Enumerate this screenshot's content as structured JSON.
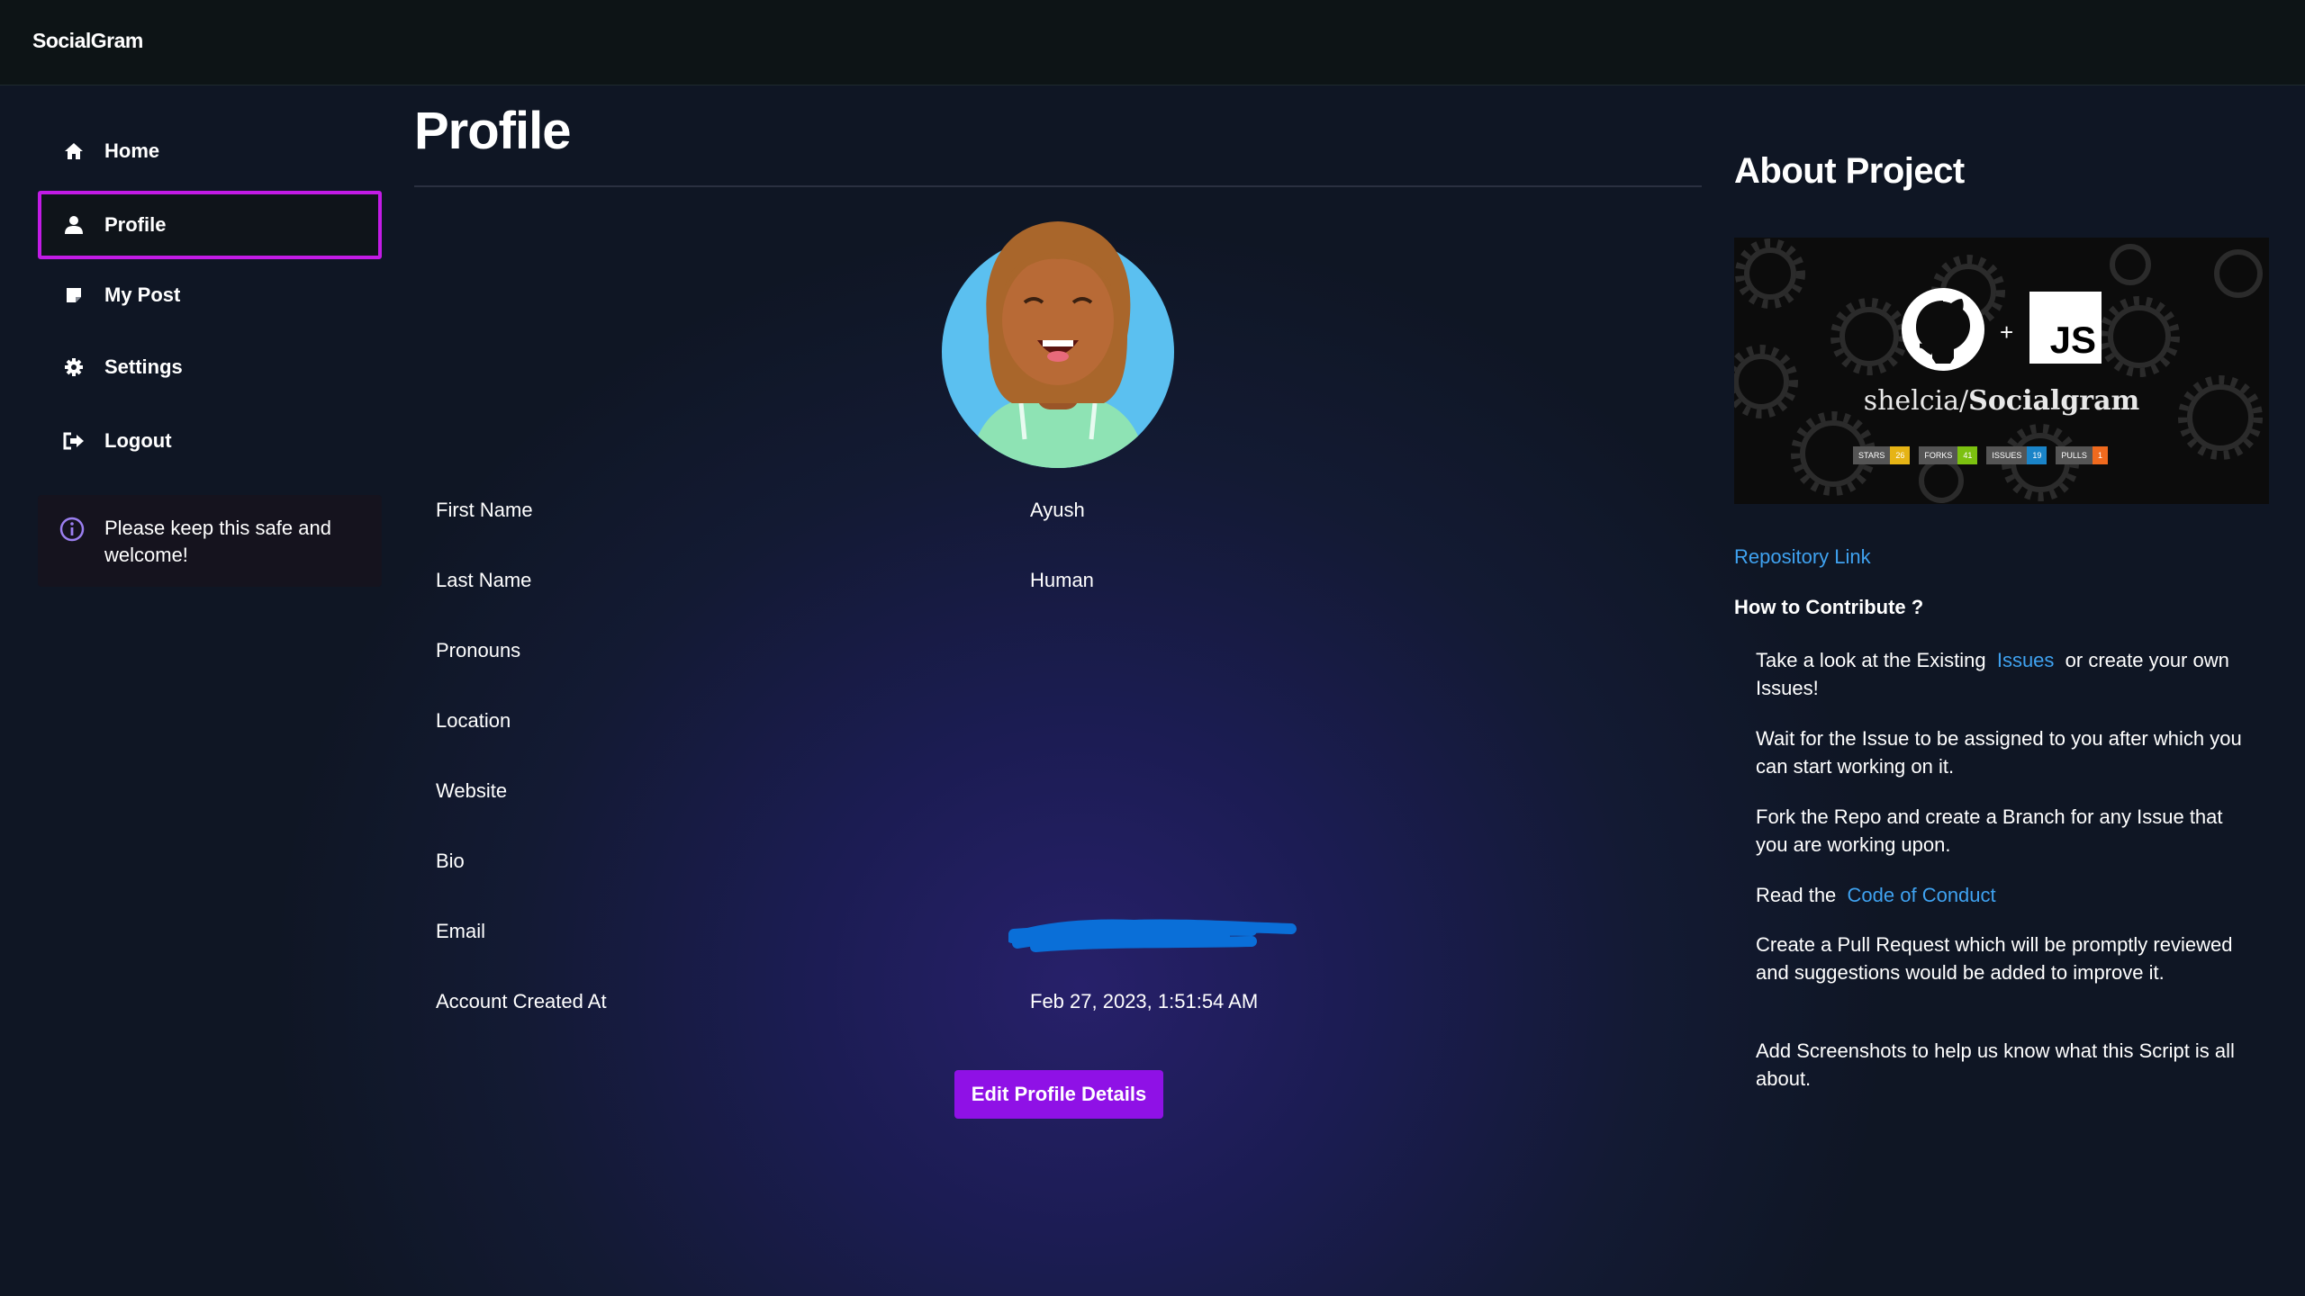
{
  "app": {
    "brand": "SocialGram"
  },
  "sidebar": {
    "items": [
      {
        "label": "Home",
        "icon": "home-icon"
      },
      {
        "label": "Profile",
        "icon": "user-icon",
        "active": true
      },
      {
        "label": "My Post",
        "icon": "note-icon"
      },
      {
        "label": "Settings",
        "icon": "gear-icon"
      },
      {
        "label": "Logout",
        "icon": "logout-icon"
      }
    ],
    "info_text": "Please keep this safe and welcome!"
  },
  "profile": {
    "title": "Profile",
    "fields": [
      {
        "label": "First Name",
        "value": "Ayush"
      },
      {
        "label": "Last Name",
        "value": "Human"
      },
      {
        "label": "Pronouns",
        "value": ""
      },
      {
        "label": "Location",
        "value": ""
      },
      {
        "label": "Website",
        "value": ""
      },
      {
        "label": "Bio",
        "value": ""
      },
      {
        "label": "Email",
        "value": "",
        "redacted": true
      },
      {
        "label": "Account Created At",
        "value": "Feb 27, 2023, 1:51:54 AM"
      }
    ],
    "edit_button": "Edit Profile Details"
  },
  "about": {
    "title": "About Project",
    "banner": {
      "repo_owner": "shelcia/",
      "repo_name": "Socialgram",
      "js_label": "JS",
      "plus": "+",
      "badges": [
        {
          "label": "STARS",
          "value": "26",
          "color": "#e6b415"
        },
        {
          "label": "FORKS",
          "value": "41",
          "color": "#7cc110"
        },
        {
          "label": "ISSUES",
          "value": "19",
          "color": "#1a84c8"
        },
        {
          "label": "PULLS",
          "value": "1",
          "color": "#f06a1e"
        }
      ]
    },
    "repo_link": "Repository Link",
    "contribute_title": "How to Contribute ?",
    "steps": {
      "s1_pre": "Take a look at the Existing",
      "s1_link": "Issues",
      "s1_post": "or create your own Issues!",
      "s2": "Wait for the Issue to be assigned to you after which you can start working on it.",
      "s3": "Fork the Repo and create a Branch for any Issue that you are working upon.",
      "s4_pre": "Read the",
      "s4_link": "Code of Conduct",
      "s5": "Create a Pull Request which will be promptly reviewed and suggestions would be added to improve it.",
      "s6": "Add Screenshots to help us know what this Script is all about."
    }
  },
  "colors": {
    "accent": "#8f11e6",
    "active_border": "#c21be6",
    "link": "#3fa2f0",
    "redaction": "#0a6fd8"
  }
}
